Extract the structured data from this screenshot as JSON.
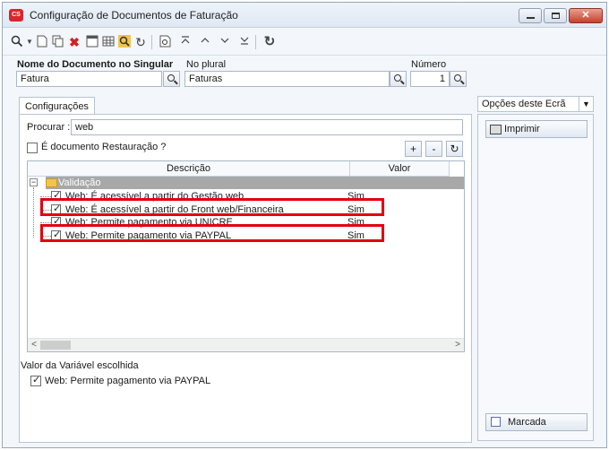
{
  "window": {
    "title": "Configuração de Documentos de Faturação",
    "logo_text": "CS",
    "close_glyph": "✕"
  },
  "toolbar": {
    "icons": [
      "search-icon",
      "new-document-icon",
      "copy-icon",
      "delete-icon",
      "list-icon",
      "grid-icon",
      "find-icon",
      "refresh-icon",
      "preview-icon",
      "first-icon",
      "previous-icon",
      "next-icon",
      "last-icon",
      "reload-icon"
    ]
  },
  "header": {
    "singular_label": "Nome do Documento no Singular",
    "singular_value": "Fatura",
    "plural_label": "No plural",
    "plural_value": "Faturas",
    "number_label": "Número",
    "number_value": "1"
  },
  "tab": {
    "label": "Configurações"
  },
  "search": {
    "label": "Procurar :",
    "value": "web"
  },
  "restore_doc": {
    "label": "É documento Restauração ?",
    "checked": false
  },
  "buttons": {
    "add": "+",
    "remove": "-",
    "refresh": "↻"
  },
  "grid": {
    "col_description": "Descrição",
    "col_value": "Valor",
    "group": "Validação",
    "rows": [
      {
        "description": "Web: É acessível a partir do Gestão web",
        "value": "Sim",
        "checked": true
      },
      {
        "description": "Web: É acessível a partir do Front web/Financeira",
        "value": "Sim",
        "checked": true
      },
      {
        "description": "Web: Permite pagamento via UNICRE",
        "value": "Sim",
        "checked": true
      },
      {
        "description": "Web: Permite pagamento via PAYPAL",
        "value": "Sim",
        "checked": true
      }
    ]
  },
  "selected_variable": {
    "label": "Valor da Variável escolhida",
    "value": "Web: Permite pagamento via PAYPAL",
    "checked": true
  },
  "side": {
    "options_label": "Opções deste Ecrã",
    "print_label": "Imprimir",
    "marked_label": "Marcada"
  },
  "colors": {
    "highlight": "#e3000f",
    "group_bg": "#a8a8a8",
    "title_logo": "#d8262c"
  }
}
